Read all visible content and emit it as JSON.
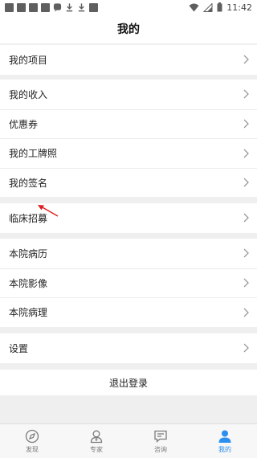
{
  "status_bar": {
    "time": "11:42"
  },
  "header": {
    "title": "我的"
  },
  "groups": [
    {
      "items": [
        {
          "label": "我的项目"
        }
      ]
    },
    {
      "items": [
        {
          "label": "我的收入"
        },
        {
          "label": "优惠券"
        },
        {
          "label": "我的工牌照"
        },
        {
          "label": "我的签名"
        }
      ]
    },
    {
      "items": [
        {
          "label": "临床招募"
        }
      ]
    },
    {
      "items": [
        {
          "label": "本院病历"
        },
        {
          "label": "本院影像"
        },
        {
          "label": "本院病理"
        }
      ]
    },
    {
      "items": [
        {
          "label": "设置"
        }
      ]
    }
  ],
  "logout": {
    "label": "退出登录"
  },
  "tabbar": {
    "active_color": "#2b8ff0",
    "tabs": [
      {
        "label": "发现",
        "icon": "compass-icon"
      },
      {
        "label": "专家",
        "icon": "experts-icon"
      },
      {
        "label": "咨询",
        "icon": "chat-icon"
      },
      {
        "label": "我的",
        "icon": "person-icon",
        "active": true
      }
    ]
  }
}
